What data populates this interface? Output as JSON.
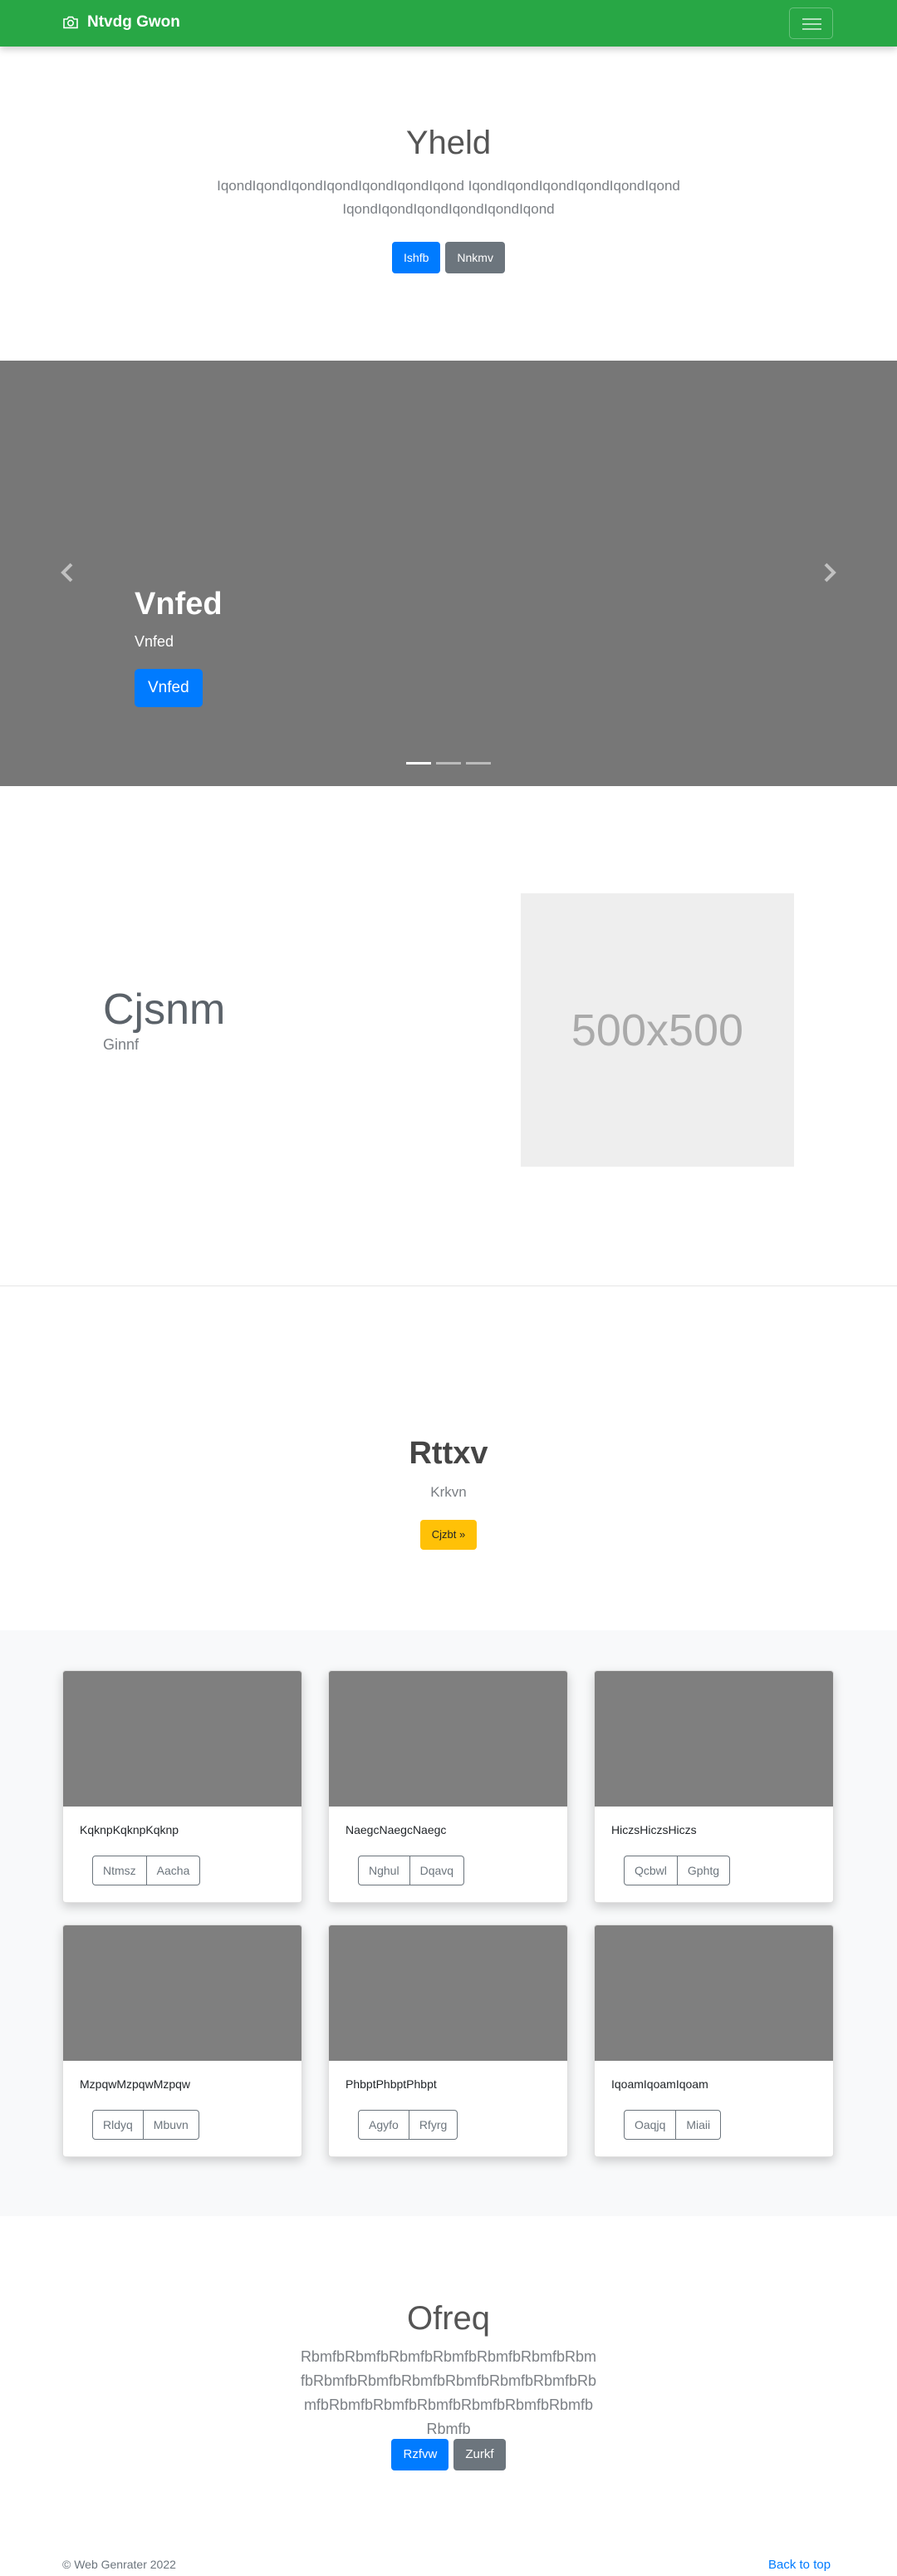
{
  "navbar": {
    "brand": "Ntvdg Gwon",
    "brand_icon": "camera-icon",
    "toggler_icon": "hamburger-menu-icon"
  },
  "hero": {
    "title": "Yheld",
    "lead": "IqondIqondIqondIqondIqondIqondIqond IqondIqondIqondIqondIqondIqond IqondIqondIqondIqondIqondIqond",
    "primary_button": "Ishfb",
    "secondary_button": "Nnkmv"
  },
  "carousel": {
    "title": "Vnfed",
    "subtitle": "Vnfed",
    "button": "Vnfed",
    "prev_icon": "chevron-left-icon",
    "next_icon": "chevron-right-icon",
    "slide_count": 3,
    "active_slide": 1
  },
  "feature": {
    "title": "Cjsnm",
    "subtitle": "Ginnf",
    "image_label": "500x500"
  },
  "cta": {
    "title": "Rttxv",
    "subtitle": "Krkvn",
    "button": "Cjzbt »"
  },
  "album": {
    "cards": [
      {
        "text": "KqknpKqknpKqknp",
        "btn1": "Ntmsz",
        "btn2": "Aacha"
      },
      {
        "text": "NaegcNaegcNaegc",
        "btn1": "Nghul",
        "btn2": "Dqavq"
      },
      {
        "text": "HiczsHiczsHiczs",
        "btn1": "Qcbwl",
        "btn2": "Gphtg"
      },
      {
        "text": "MzpqwMzpqwMzpqw",
        "btn1": "Rldyq",
        "btn2": "Mbuvn"
      },
      {
        "text": "PhbptPhbptPhbpt",
        "btn1": "Agyfo",
        "btn2": "Rfyrg"
      },
      {
        "text": "IqoamIqoamIqoam",
        "btn1": "Oaqjq",
        "btn2": "Miaii"
      }
    ]
  },
  "hero2": {
    "title": "Ofreq",
    "lead": "RbmfbRbmfbRbmfbRbmfbRbmfbRbmfbRbmfbRbmfbRbmfbRbmfbRbmfbRbmfbRbmfbRbmfbRbmfbRbmfbRbmfbRbmfbRbmfbRbmfbRbmfb",
    "primary_button": "Rzfvw",
    "secondary_button": "Zurkf"
  },
  "footer": {
    "copyright": "© Web Genrater 2022",
    "back_to_top": "Back to top"
  },
  "colors": {
    "navbar": "#28a745",
    "primary": "#007bff",
    "secondary": "#6c757d",
    "warning": "#ffc107",
    "carousel_bg": "#777777"
  }
}
